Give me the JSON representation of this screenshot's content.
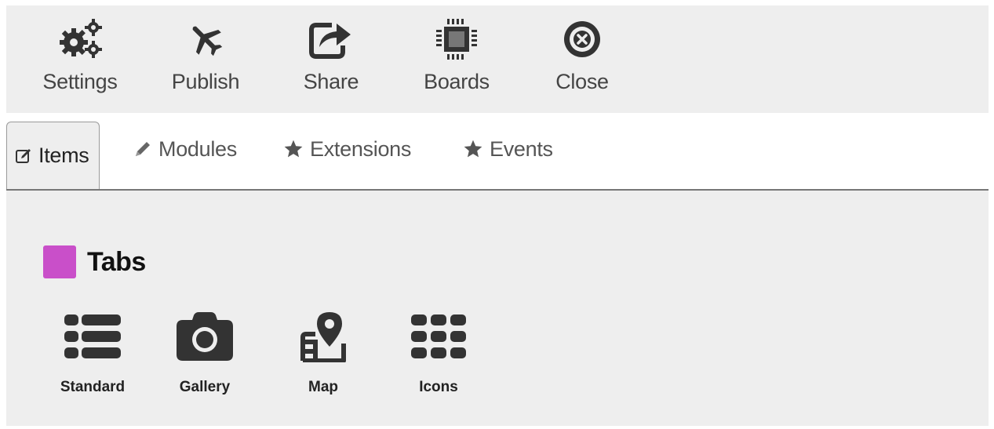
{
  "toolbar": {
    "buttons": [
      {
        "label": "Settings",
        "icon": "cogs-icon"
      },
      {
        "label": "Publish",
        "icon": "plane-icon"
      },
      {
        "label": "Share",
        "icon": "share-icon"
      },
      {
        "label": "Boards",
        "icon": "chip-icon"
      },
      {
        "label": "Close",
        "icon": "close-circle-icon"
      }
    ]
  },
  "tabs": [
    {
      "label": "Items",
      "icon": "edit-icon",
      "active": true
    },
    {
      "label": "Modules",
      "icon": "pencil-icon",
      "active": false
    },
    {
      "label": "Extensions",
      "icon": "star-icon",
      "active": false
    },
    {
      "label": "Events",
      "icon": "star-icon",
      "active": false
    }
  ],
  "section": {
    "title": "Tabs",
    "color": "#c94fc9"
  },
  "items": [
    {
      "label": "Standard",
      "icon": "list-icon"
    },
    {
      "label": "Gallery",
      "icon": "camera-icon"
    },
    {
      "label": "Map",
      "icon": "map-pin-icon"
    },
    {
      "label": "Icons",
      "icon": "grid-icon"
    }
  ],
  "colors": {
    "icon": "#333333",
    "toolbar_bg": "#eeeeee",
    "accent": "#c94fc9"
  }
}
